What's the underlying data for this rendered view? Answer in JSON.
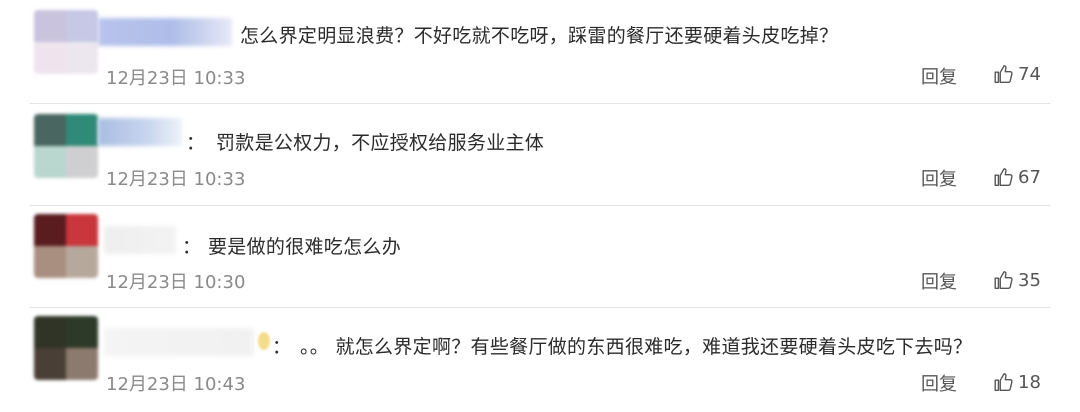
{
  "comments": [
    {
      "text": "怎么界定明显浪费？不好吃就不吃呀，踩雷的餐厅还要硬着头皮吃掉？",
      "time": "12月23日 10:33",
      "reply_label": "回复",
      "likes": "74"
    },
    {
      "text": "罚款是公权力，不应授权给服务业主体",
      "time": "12月23日 10:33",
      "reply_label": "回复",
      "likes": "67"
    },
    {
      "text": "要是做的很难吃怎么办",
      "time": "12月23日 10:30",
      "reply_label": "回复",
      "likes": "35"
    },
    {
      "text": "。。 就怎么界定啊？有些餐厅做的东西很难吃，难道我还要硬着头皮吃下去吗？",
      "time": "12月23日 10:43",
      "reply_label": "回复",
      "likes": "18"
    }
  ],
  "colon": "：",
  "icons": {
    "like": "thumbs-up-icon"
  },
  "colors": {
    "text": "#2b2b2b",
    "meta": "#8a8a8a",
    "divider": "#e3e3e3"
  }
}
